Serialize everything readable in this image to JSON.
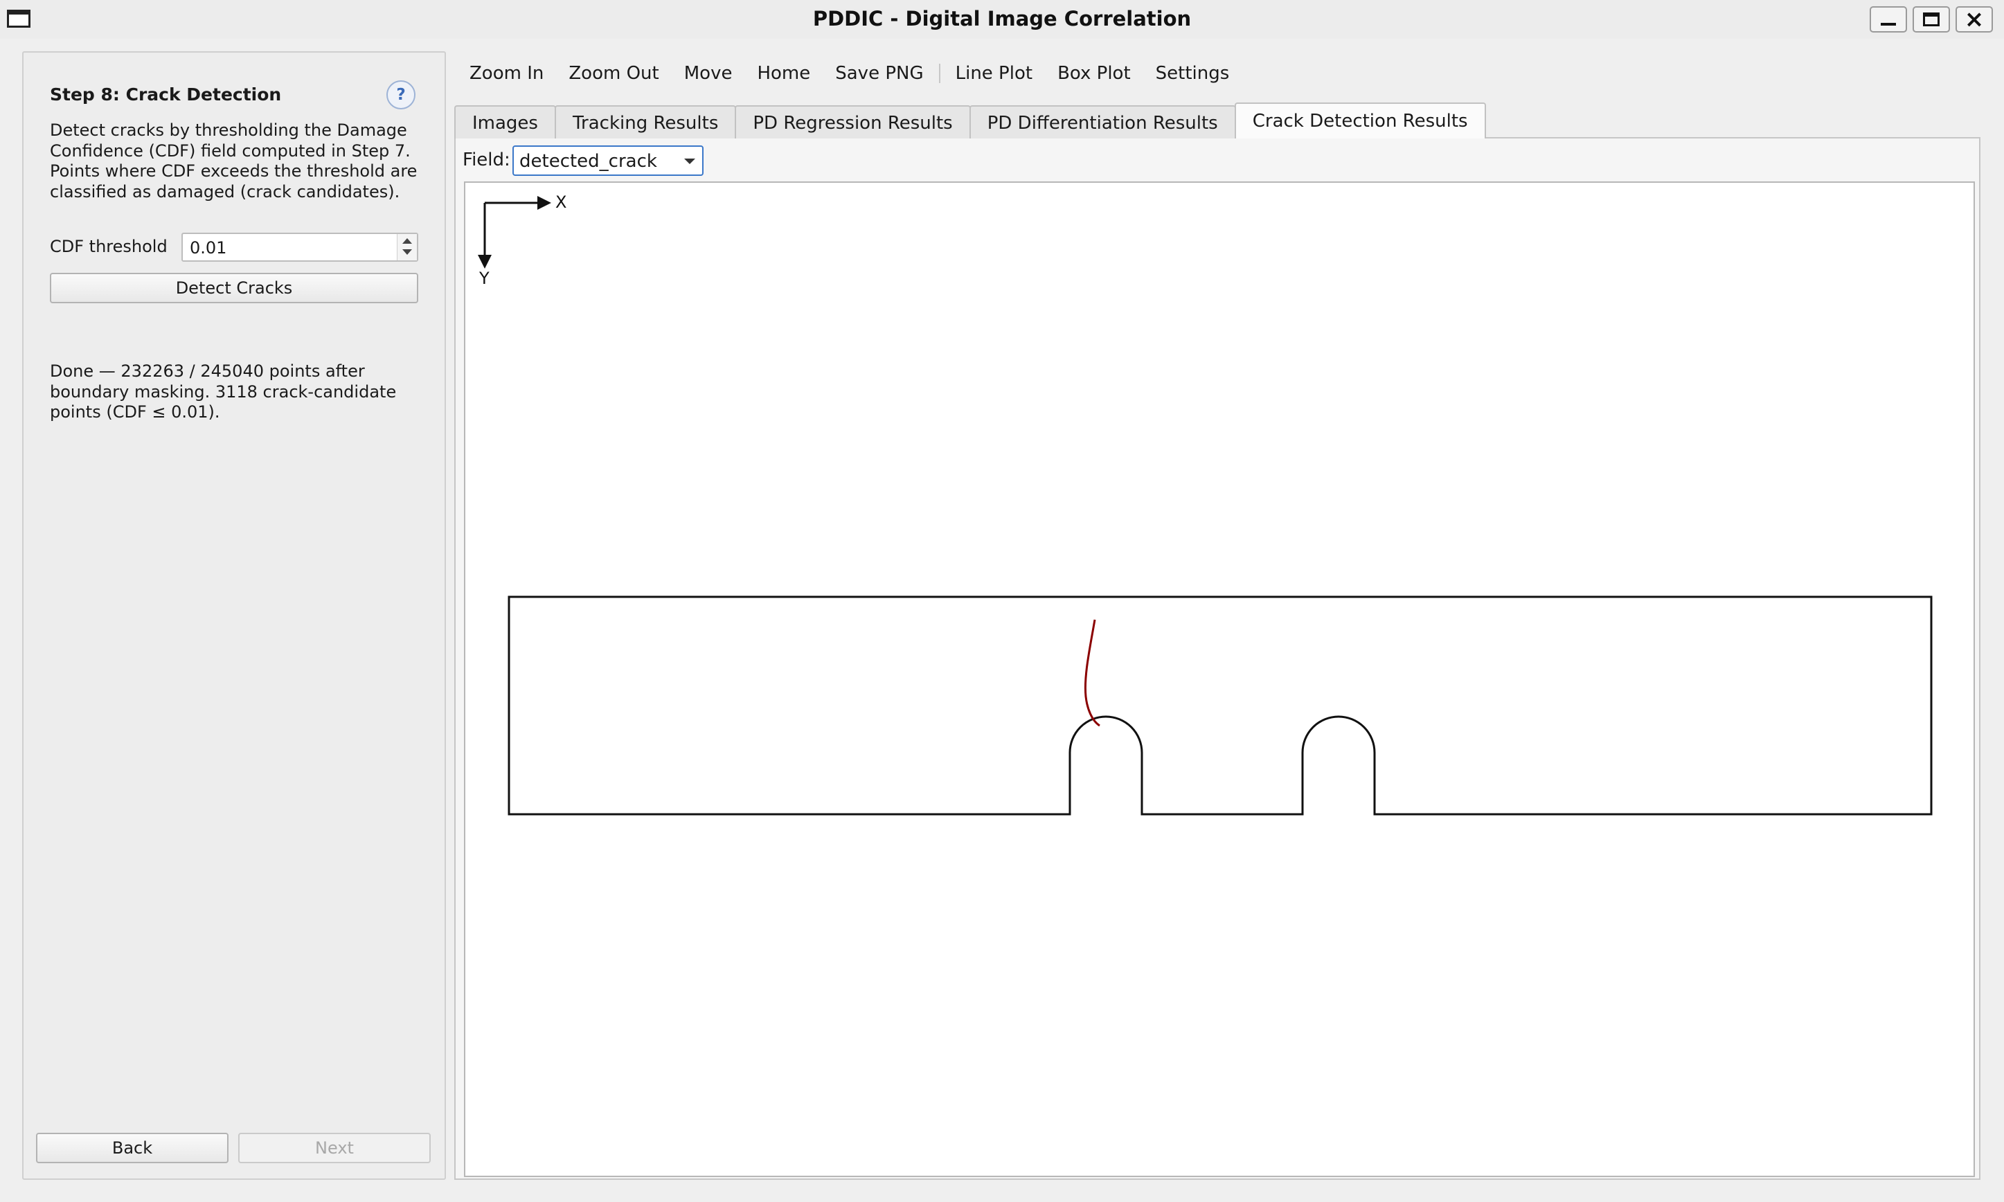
{
  "window": {
    "title": "PDDIC - Digital Image Correlation"
  },
  "left_panel": {
    "step_title": "Step 8: Crack Detection",
    "help_label": "?",
    "description": "Detect cracks by thresholding the Damage Confidence (CDF) field computed in Step 7. Points where CDF exceeds the threshold are classified as damaged (crack candidates).",
    "cdf_threshold_label": "CDF threshold",
    "cdf_threshold_value": "0.01",
    "detect_button": "Detect Cracks",
    "status": "Done — 232263 / 245040 points after boundary masking. 3118 crack-candidate points (CDF ≤ 0.01).",
    "back_button": "Back",
    "next_button": "Next"
  },
  "toolbar": {
    "zoom_in": "Zoom In",
    "zoom_out": "Zoom Out",
    "move": "Move",
    "home": "Home",
    "save_png": "Save PNG",
    "line_plot": "Line Plot",
    "box_plot": "Box Plot",
    "settings": "Settings"
  },
  "tabs": [
    {
      "label": "Images",
      "active": false
    },
    {
      "label": "Tracking Results",
      "active": false
    },
    {
      "label": "PD Regression Results",
      "active": false
    },
    {
      "label": "PD Differentiation Results",
      "active": false
    },
    {
      "label": "Crack Detection Results",
      "active": true
    }
  ],
  "field": {
    "label": "Field:",
    "value": "detected_crack"
  },
  "plot": {
    "axis_x_label": "X",
    "axis_y_label": "Y",
    "outline_color": "#111111",
    "crack_color": "#8b0000"
  }
}
